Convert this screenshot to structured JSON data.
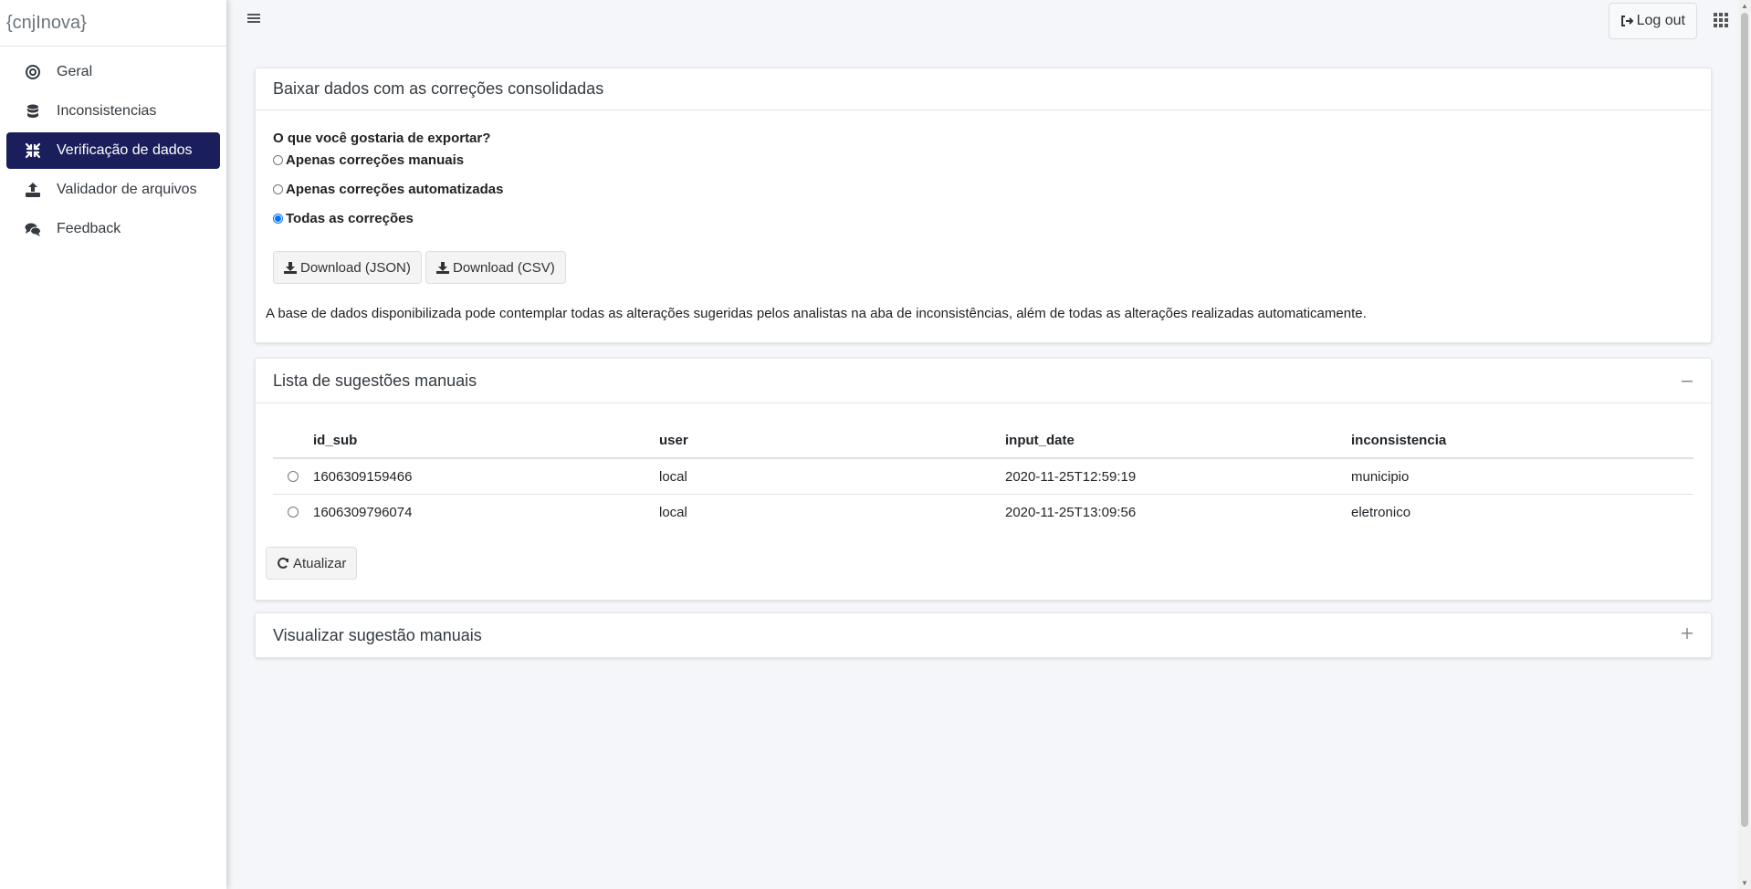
{
  "brand": "{cnjInova}",
  "sidebar": {
    "items": [
      {
        "label": "Geral",
        "icon": "target-icon",
        "active": false
      },
      {
        "label": "Inconsistencias",
        "icon": "database-icon",
        "active": false
      },
      {
        "label": "Verificação de dados",
        "icon": "compress-arrows-icon",
        "active": true
      },
      {
        "label": "Validador de arquivos",
        "icon": "upload-icon",
        "active": false
      },
      {
        "label": "Feedback",
        "icon": "comments-icon",
        "active": false
      }
    ]
  },
  "topbar": {
    "logout_label": "Log out"
  },
  "export_card": {
    "title": "Baixar dados com as correções consolidadas",
    "question": "O que você gostaria de exportar?",
    "options": [
      {
        "label": "Apenas correções manuais",
        "checked": false
      },
      {
        "label": "Apenas correções automatizadas",
        "checked": false
      },
      {
        "label": "Todas as correções",
        "checked": true
      }
    ],
    "download_json_label": "Download (JSON)",
    "download_csv_label": "Download (CSV)",
    "info": "A base de dados disponibilizada pode contemplar todas as alterações sugeridas pelos analistas na aba de inconsistências, além de todas as alterações realizadas automaticamente."
  },
  "suggestions_card": {
    "title": "Lista de sugestões manuais",
    "columns": [
      "id_sub",
      "user",
      "input_date",
      "inconsistencia"
    ],
    "rows": [
      [
        "1606309159466",
        "local",
        "2020-11-25T12:59:19",
        "municipio"
      ],
      [
        "1606309796074",
        "local",
        "2020-11-25T13:09:56",
        "eletronico"
      ]
    ],
    "refresh_label": "Atualizar"
  },
  "view_card": {
    "title": "Visualizar sugestão manuais"
  },
  "colors": {
    "active_nav": "#1a1f5c",
    "radio_checked": "#0075ff",
    "background": "#f4f6f9"
  }
}
